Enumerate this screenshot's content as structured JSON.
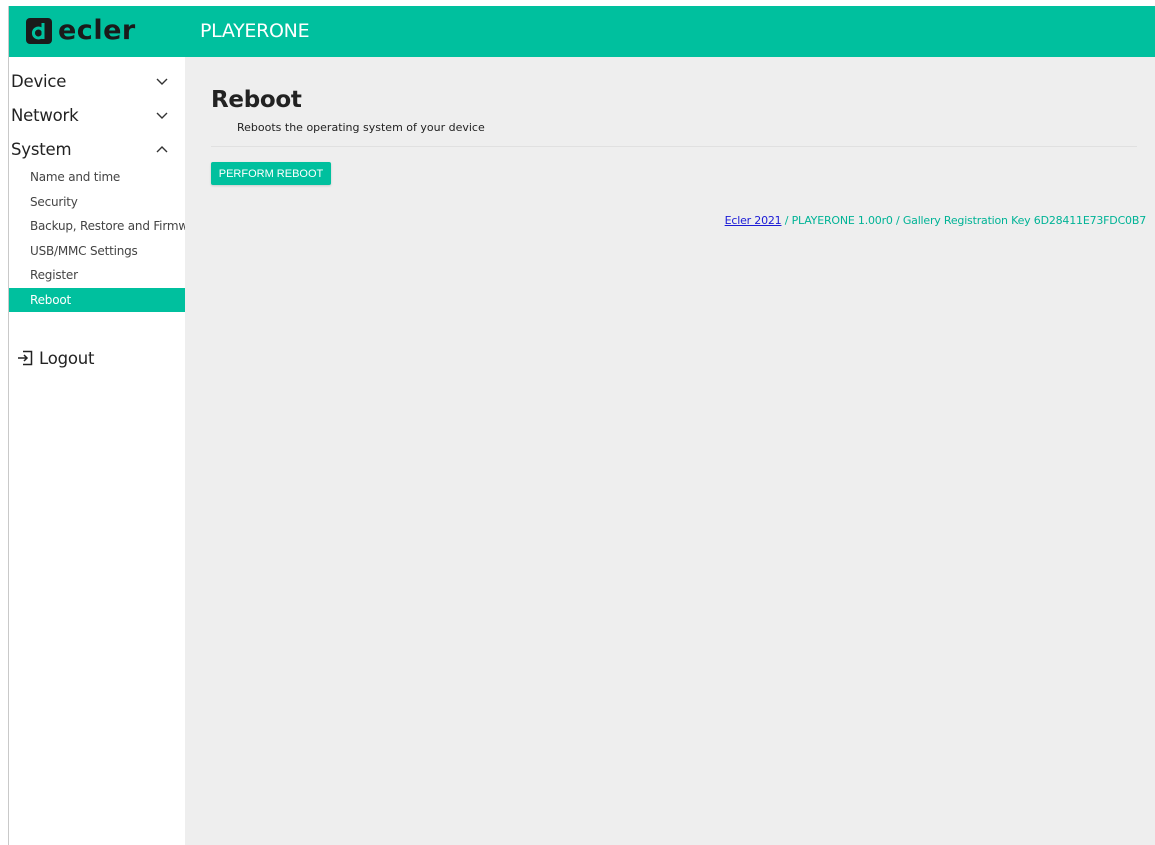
{
  "header": {
    "brand": "ecler",
    "app_title": "PLAYERONE"
  },
  "sidebar": {
    "groups": [
      {
        "label": "Device",
        "expanded": false
      },
      {
        "label": "Network",
        "expanded": false
      },
      {
        "label": "System",
        "expanded": true
      }
    ],
    "system_items": [
      {
        "label": "Name and time"
      },
      {
        "label": "Security"
      },
      {
        "label": "Backup, Restore and Firmware"
      },
      {
        "label": "USB/MMC Settings"
      },
      {
        "label": "Register"
      },
      {
        "label": "Reboot",
        "active": true
      }
    ],
    "logout_label": "Logout"
  },
  "main": {
    "title": "Reboot",
    "description": "Reboots the operating system of your device",
    "button_label": "PERFORM REBOOT"
  },
  "footer": {
    "link_text": "Ecler 2021",
    "text": " / PLAYERONE 1.00r0 / Gallery Registration Key 6D28411E73FDC0B7"
  },
  "colors": {
    "accent": "#00c09e",
    "background": "#eeeeee",
    "link": "#1a1ad6"
  }
}
